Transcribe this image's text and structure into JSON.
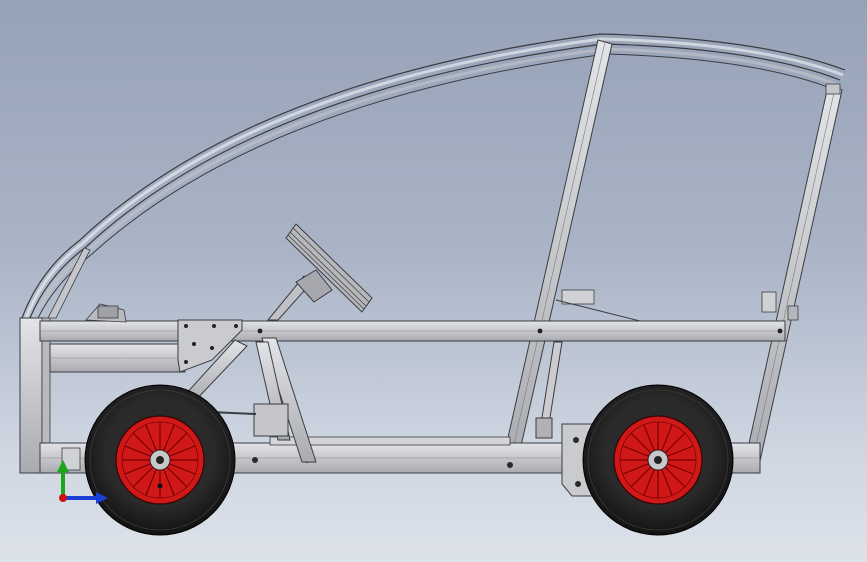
{
  "viewport": {
    "background_top": "#96a2b8",
    "background_bottom": "#dde2ea"
  },
  "colors": {
    "frame": "#c4c6ca",
    "frame_stroke": "#3a3c40",
    "tire": "#1b1b1b",
    "rim": "#d01818",
    "hub": "#c8c8cc",
    "axis_x": "#1a3fd6",
    "axis_y": "#1aa51a",
    "axis_z": "#cc1111"
  },
  "icons": {
    "triad": "coordinate-triad-icon"
  }
}
